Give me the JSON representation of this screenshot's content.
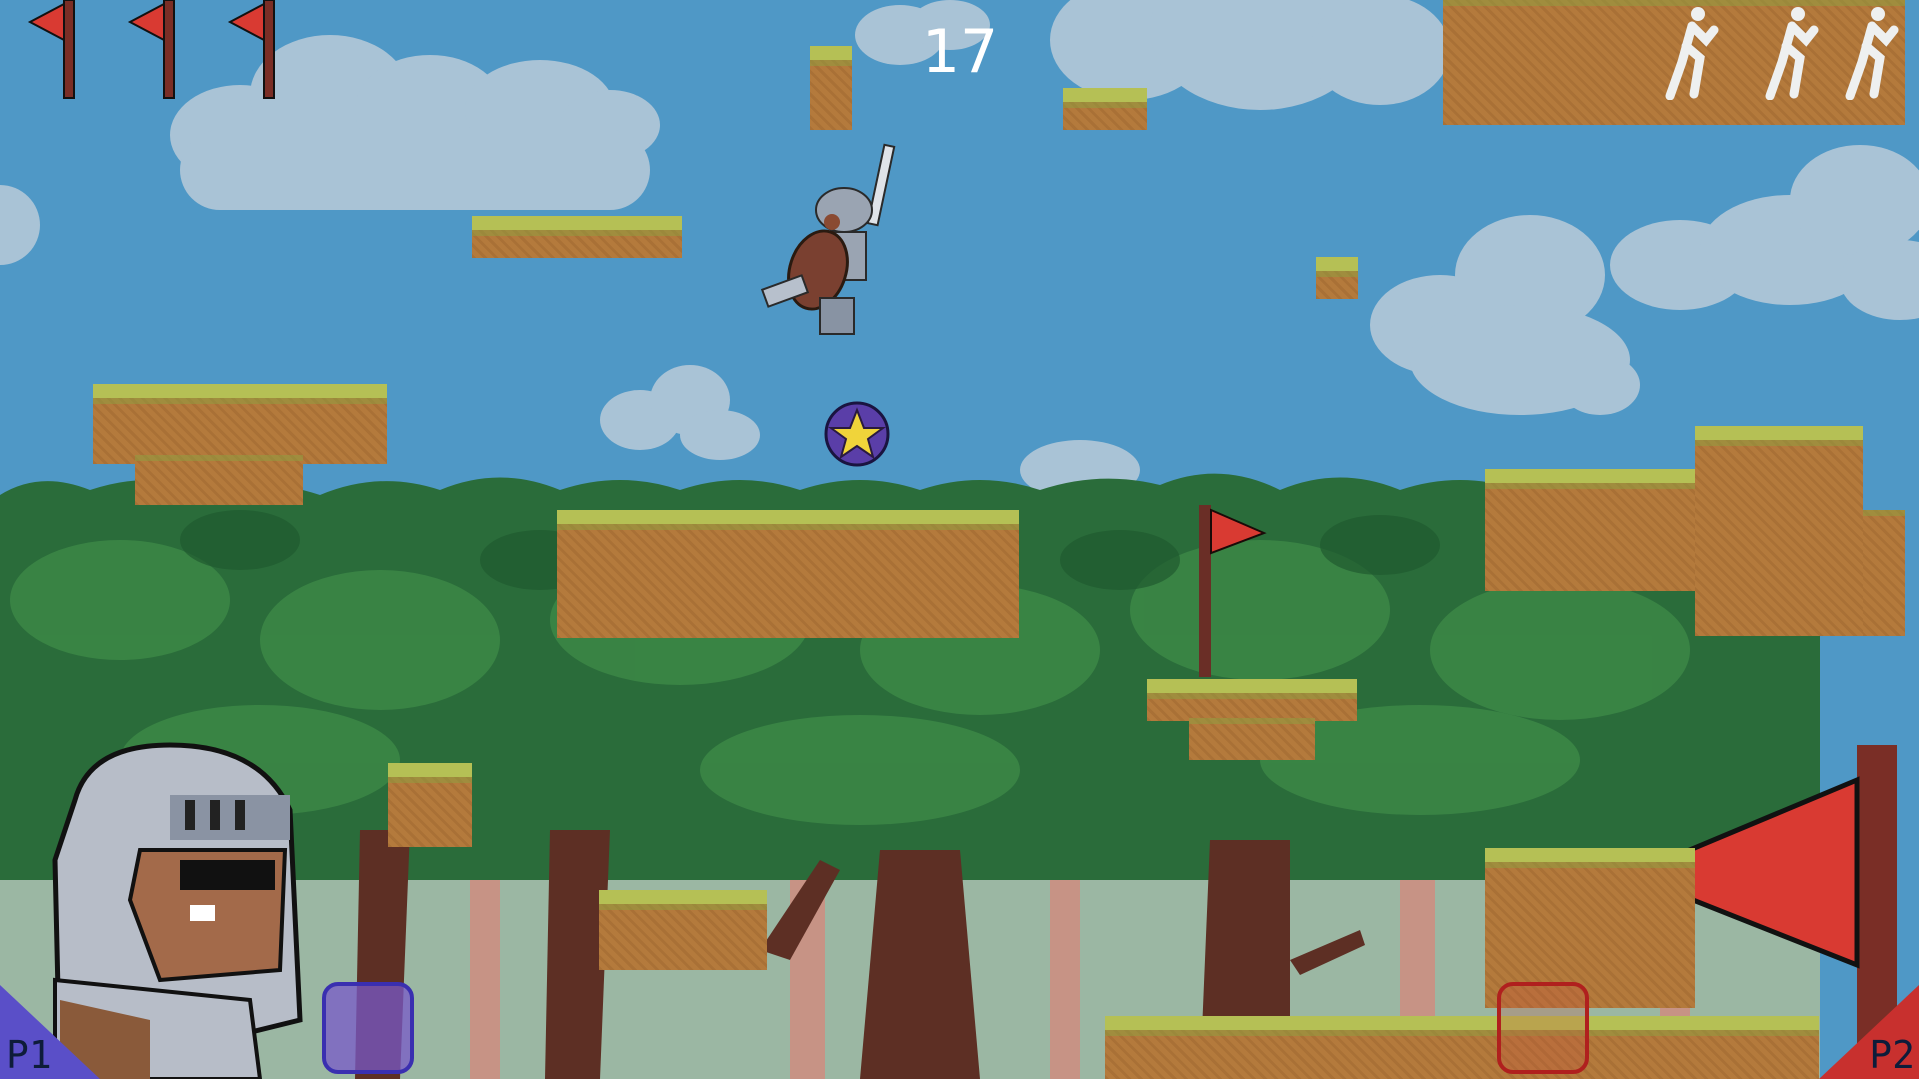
{
  "hud": {
    "score": "17",
    "player1_label": "P1",
    "player2_label": "P2",
    "player1_flags_remaining": 3,
    "player2_lives_remaining": 3
  },
  "colors": {
    "sky": "#4f98c6",
    "grass": "#b5c055",
    "dirt": "#b47a3c",
    "p1_accent": "#5a4fc8",
    "p2_accent": "#c8302e",
    "flag_red": "#d93a32"
  },
  "icons": {
    "flag": "red-pennant-flag",
    "life": "running-figure",
    "pickup": "star-orb"
  }
}
